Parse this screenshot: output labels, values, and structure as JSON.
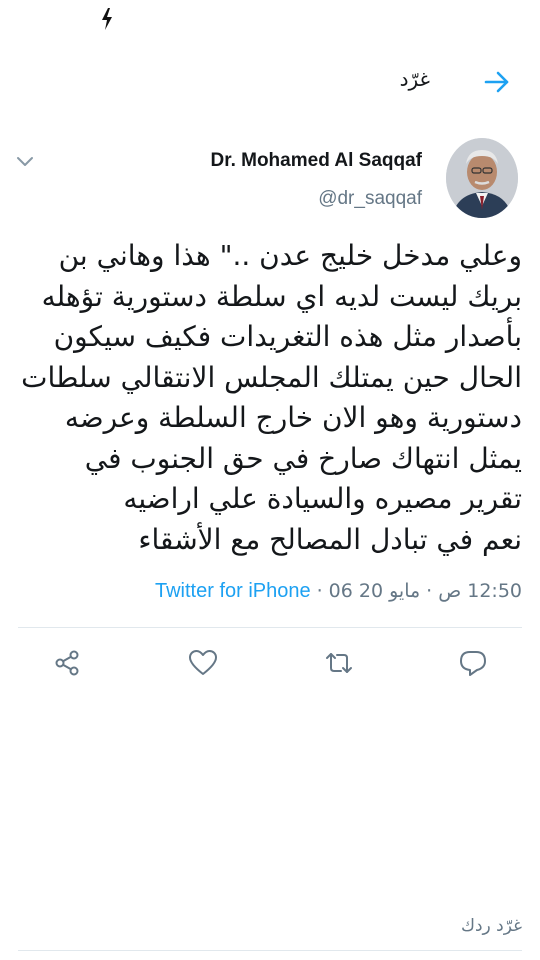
{
  "status_bar": {
    "icon": "flash-icon"
  },
  "header": {
    "title": "غرّد",
    "back_icon": "arrow-right-icon"
  },
  "author": {
    "name": "Dr. Mohamed Al Saqqaf",
    "handle": "@dr_saqqaf",
    "avatar_icon": "avatar",
    "menu_icon": "chevron-down-icon"
  },
  "tweet": {
    "lines": [
      "وعلي مدخل خليج عدن ..\" هذا وهاني بن",
      "بريك ليست لديه اي سلطة دستورية تؤهله",
      "بأصدار مثل هذه التغريدات فكيف سيكون",
      "الحال حين يمتلك المجلس الانتقالي سلطات",
      "دستورية وهو الان خارج السلطة وعرضه",
      "يمثل انتهاك صارخ في حق الجنوب في",
      "تقرير مصيره والسيادة علي اراضيه",
      "نعم في تبادل المصالح مع الأشقاء"
    ],
    "time": "12:50 ص",
    "date": "06 مايو 20",
    "separator": "·",
    "source": "Twitter for iPhone"
  },
  "actions": {
    "reply_icon": "reply-icon",
    "retweet_icon": "retweet-icon",
    "like_icon": "heart-icon",
    "share_icon": "share-icon"
  },
  "reply_bar": {
    "label": "غرّد ردك"
  },
  "colors": {
    "accent": "#1da1f2",
    "text": "#14171a",
    "muted": "#657786",
    "divider": "#e1e8ed"
  }
}
